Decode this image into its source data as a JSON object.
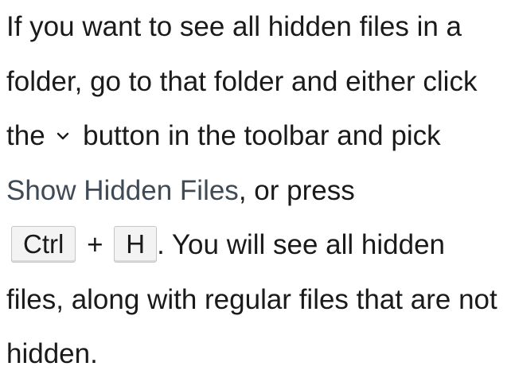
{
  "text": {
    "p1": "If you want to see all hidden files in a folder, go to that folder and either click the",
    "p2": "button in the toolbar and pick",
    "gui_menu_item": "Show Hidden Files",
    "p3": ", or press",
    "key_ctrl": "Ctrl",
    "plus": "+",
    "key_h": "H",
    "p4": ". You will see all hidden files, along with regular files that are not hidden."
  },
  "icons": {
    "toolbar_menu": "chevron-down-icon"
  },
  "colors": {
    "text": "#1a1a1a",
    "gui_text": "#3f4a55",
    "key_background": "#f3f3f3",
    "key_border": "#c6c6c6"
  }
}
